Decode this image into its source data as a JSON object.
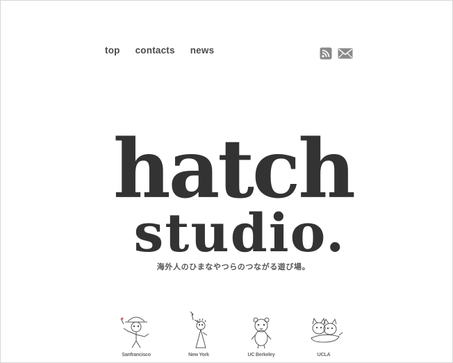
{
  "nav": {
    "items": [
      {
        "label": "top"
      },
      {
        "label": "contacts"
      },
      {
        "label": "news"
      }
    ]
  },
  "social": {
    "rss_icon": "rss-icon",
    "mail_icon": "mail-icon"
  },
  "logo": {
    "line1": "hatch",
    "line2": "studio."
  },
  "tagline": "海外人のひまなやつらのつながる遊び場。",
  "characters": [
    {
      "label": "Sanfrancisco",
      "icon": "cowboy-character-icon"
    },
    {
      "label": "New York",
      "icon": "statue-of-liberty-character-icon"
    },
    {
      "label": "UC Berkeley",
      "icon": "bear-character-icon"
    },
    {
      "label": "UCLA",
      "icon": "cats-character-icon"
    }
  ],
  "colors": {
    "logo": "#333333",
    "nav_text": "#4a4a4a",
    "icon_bg": "#8a8a8a"
  }
}
